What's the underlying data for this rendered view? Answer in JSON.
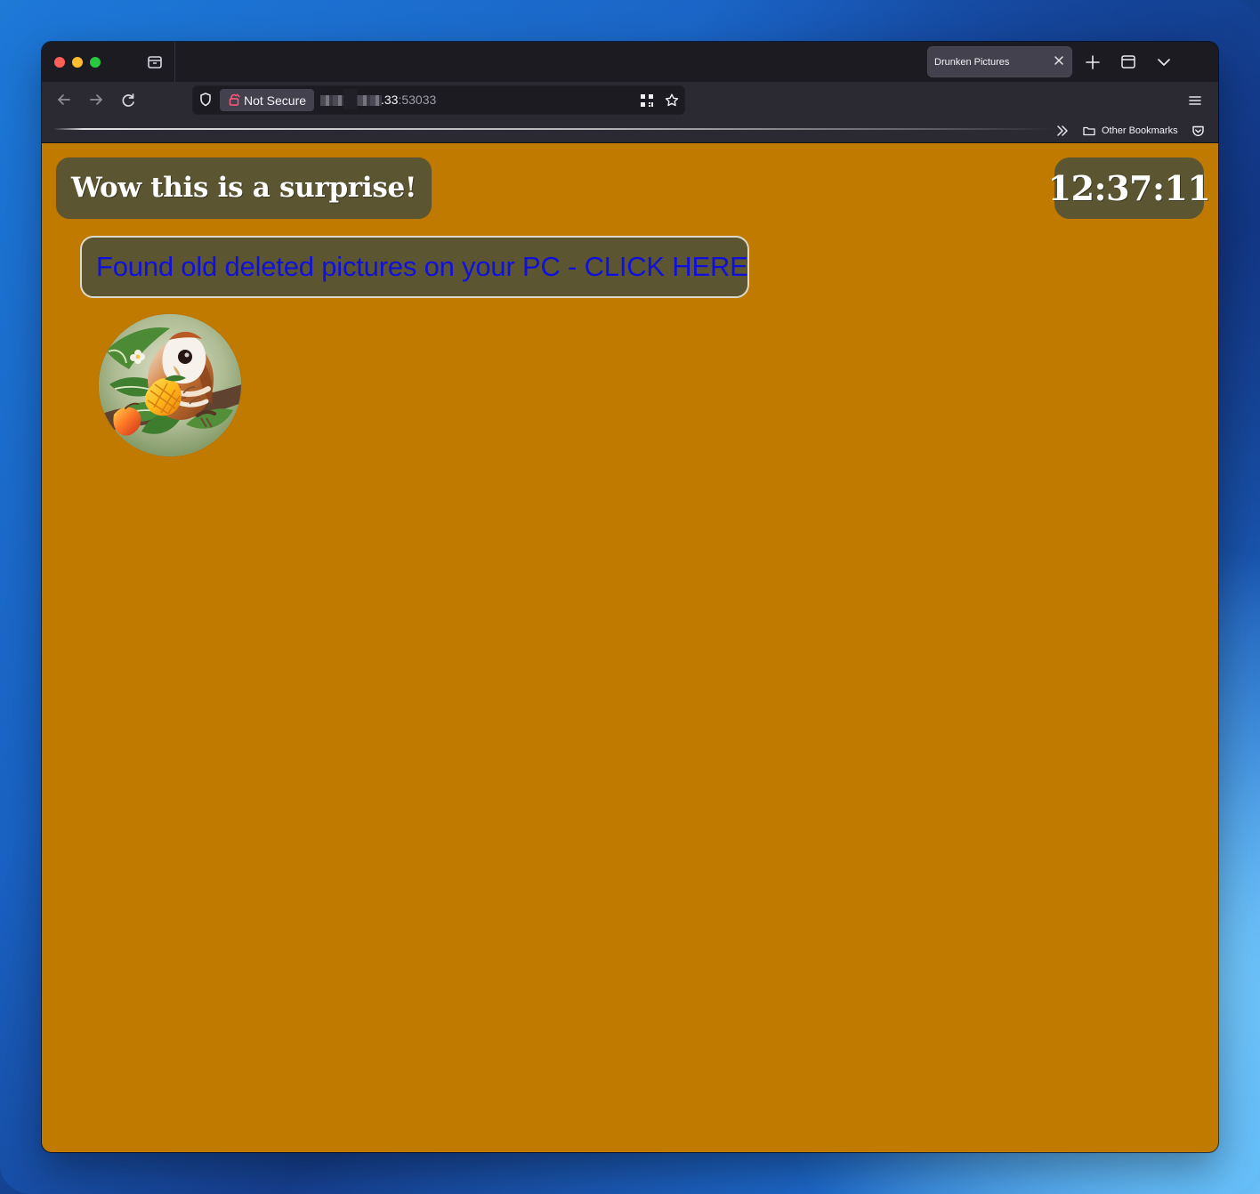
{
  "browser": {
    "tab": {
      "title": "Drunken Pictures"
    },
    "address_bar": {
      "security_label": "Not Secure",
      "host_suffix": ".33",
      "port": ":53033"
    },
    "bookmarks_bar": {
      "other_bookmarks_label": "Other Bookmarks"
    }
  },
  "page": {
    "header_message": "Wow this is a surprise!",
    "time": "12:37:11",
    "promo_link_text": "Found old deleted pictures on your PC - CLICK HERE"
  },
  "colors": {
    "page_background": "#c17a00",
    "panel_background": "#5b5631",
    "link_text": "#1110db"
  },
  "icons": {
    "close": "close-icon",
    "reload": "reload-icon",
    "star": "bookmark-star-icon",
    "menu": "menu-icon"
  }
}
